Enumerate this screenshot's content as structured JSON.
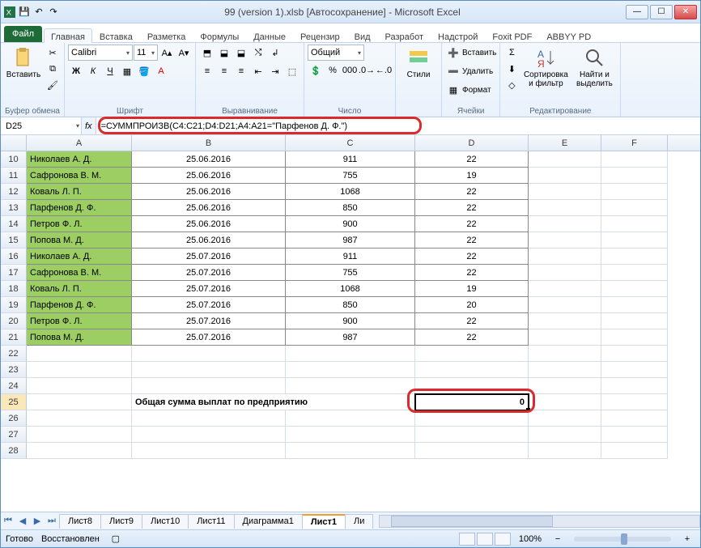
{
  "title": "99 (version 1).xlsb [Автосохранение] - Microsoft Excel",
  "tabs": {
    "file": "Файл",
    "list": [
      "Главная",
      "Вставка",
      "Разметка",
      "Формулы",
      "Данные",
      "Рецензир",
      "Вид",
      "Разработ",
      "Надстрой",
      "Foxit PDF",
      "ABBYY PD"
    ],
    "active": 0
  },
  "ribbon": {
    "clipboard": {
      "label": "Буфер обмена",
      "paste": "Вставить"
    },
    "font": {
      "label": "Шрифт",
      "name": "Calibri",
      "size": "11"
    },
    "alignment": {
      "label": "Выравнивание"
    },
    "number": {
      "label": "Число",
      "format": "Общий"
    },
    "styles": {
      "label": "Стили",
      "btn": "Стили"
    },
    "cells": {
      "label": "Ячейки",
      "insert": "Вставить",
      "delete": "Удалить",
      "format": "Формат"
    },
    "editing": {
      "label": "Редактирование",
      "sort": "Сортировка и фильтр",
      "find": "Найти и выделить"
    }
  },
  "namebox": "D25",
  "formula": "=СУММПРОИЗВ(C4:C21;D4:D21;A4:A21=\"Парфенов Д. Ф.\")",
  "cols": [
    "A",
    "B",
    "C",
    "D",
    "E",
    "F"
  ],
  "data_rows": [
    {
      "r": 10,
      "a": "Николаев А. Д.",
      "b": "25.06.2016",
      "c": "911",
      "d": "22"
    },
    {
      "r": 11,
      "a": "Сафронова В. М.",
      "b": "25.06.2016",
      "c": "755",
      "d": "19"
    },
    {
      "r": 12,
      "a": "Коваль Л. П.",
      "b": "25.06.2016",
      "c": "1068",
      "d": "22"
    },
    {
      "r": 13,
      "a": "Парфенов Д. Ф.",
      "b": "25.06.2016",
      "c": "850",
      "d": "22"
    },
    {
      "r": 14,
      "a": "Петров Ф. Л.",
      "b": "25.06.2016",
      "c": "900",
      "d": "22"
    },
    {
      "r": 15,
      "a": "Попова М. Д.",
      "b": "25.06.2016",
      "c": "987",
      "d": "22"
    },
    {
      "r": 16,
      "a": "Николаев А. Д.",
      "b": "25.07.2016",
      "c": "911",
      "d": "22"
    },
    {
      "r": 17,
      "a": "Сафронова В. М.",
      "b": "25.07.2016",
      "c": "755",
      "d": "22"
    },
    {
      "r": 18,
      "a": "Коваль Л. П.",
      "b": "25.07.2016",
      "c": "1068",
      "d": "19"
    },
    {
      "r": 19,
      "a": "Парфенов Д. Ф.",
      "b": "25.07.2016",
      "c": "850",
      "d": "20"
    },
    {
      "r": 20,
      "a": "Петров Ф. Л.",
      "b": "25.07.2016",
      "c": "900",
      "d": "22"
    },
    {
      "r": 21,
      "a": "Попова М. Д.",
      "b": "25.07.2016",
      "c": "987",
      "d": "22"
    }
  ],
  "empty_rows": [
    22,
    23,
    24
  ],
  "bold_row": {
    "r": 25,
    "label": "Общая сумма выплат по предприятию",
    "d": "0"
  },
  "trailing_rows": [
    26,
    27,
    28
  ],
  "sheets": {
    "list": [
      "Лист8",
      "Лист9",
      "Лист10",
      "Лист11",
      "Диаграмма1",
      "Лист1",
      "Ли"
    ],
    "active": 5
  },
  "status": {
    "ready": "Готово",
    "recovered": "Восстановлен",
    "zoom": "100%"
  }
}
